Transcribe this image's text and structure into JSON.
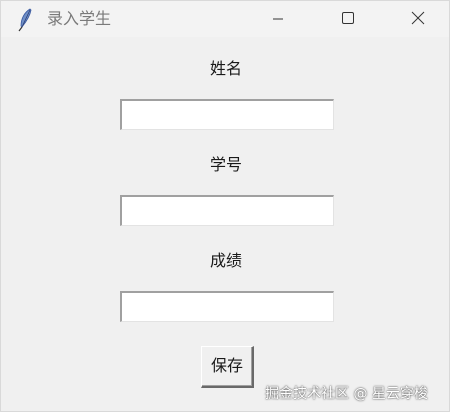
{
  "window": {
    "title": "录入学生",
    "controls": {
      "minimize": "minimize-icon",
      "maximize": "maximize-icon",
      "close": "close-icon"
    },
    "app_icon": "feather-icon"
  },
  "form": {
    "name_label": "姓名",
    "name_value": "",
    "id_label": "学号",
    "id_value": "",
    "score_label": "成绩",
    "score_value": "",
    "save_label": "保存"
  },
  "watermark": {
    "text": "掘金技术社区 @ 星云穿梭"
  },
  "colors": {
    "background": "#f0f0f0",
    "input_background": "#ffffff",
    "title_text": "#7a7a7a"
  }
}
